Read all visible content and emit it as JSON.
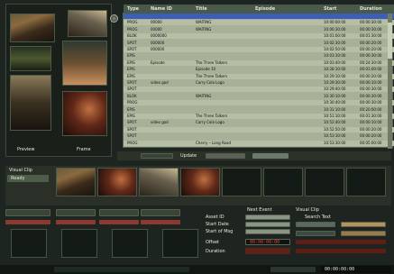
{
  "left_panel": {
    "preview_caption": "Preview",
    "frame_caption": "Frame"
  },
  "table": {
    "columns": [
      "Type",
      "Name ID",
      "Title",
      "Episode",
      "Start",
      "Duration"
    ],
    "rows": [
      {
        "type": "",
        "id": "",
        "title": "",
        "start": "",
        "duration": "",
        "selected": true
      },
      {
        "type": "PROG",
        "id": "00000",
        "title": "WAITING",
        "start": "10:00:00:00",
        "duration": "00:00:30:00"
      },
      {
        "type": "PROG",
        "id": "00000",
        "title": "WAITING",
        "start": "10:00:30:00",
        "duration": "00:00:30:00"
      },
      {
        "type": "BLOK",
        "id": "0000000",
        "title": "",
        "start": "10:01:00:00",
        "duration": "00:01:30:00"
      },
      {
        "type": "SPOT",
        "id": "000000",
        "title": "",
        "start": "10:02:30:00",
        "duration": "00:00:20:00"
      },
      {
        "type": "SPOT",
        "id": "000000",
        "title": "",
        "start": "10:02:50:00",
        "duration": "00:00:20:00"
      },
      {
        "type": "EPIS",
        "id": "",
        "title": "",
        "start": "10:03:10:00",
        "duration": "00:00:30:00"
      },
      {
        "type": "EPIS",
        "id": "Episode",
        "title": "The Three Talkers",
        "start": "10:03:40:00",
        "duration": "00:24:30:00"
      },
      {
        "type": "EPIS",
        "id": "",
        "title": "Episode 10",
        "start": "10:28:10:00",
        "duration": "00:01:00:00"
      },
      {
        "type": "EPIS",
        "id": "",
        "title": "The Three Talkers",
        "start": "10:29:10:00",
        "duration": "00:00:20:00"
      },
      {
        "type": "SPOT",
        "id": "video god",
        "title": "Carry Cola Logo",
        "start": "10:29:30:00",
        "duration": "00:00:10:00"
      },
      {
        "type": "SPOT",
        "id": "",
        "title": "",
        "start": "10:29:40:00",
        "duration": "00:00:30:00"
      },
      {
        "type": "BLOK",
        "id": "",
        "title": "WAITING",
        "start": "10:30:10:00",
        "duration": "00:00:30:00"
      },
      {
        "type": "PROG",
        "id": "",
        "title": "",
        "start": "10:30:40:00",
        "duration": "00:00:30:00"
      },
      {
        "type": "EPIS",
        "id": "",
        "title": "",
        "start": "10:31:10:00",
        "duration": "00:20:00:00"
      },
      {
        "type": "EPIS",
        "id": "",
        "title": "The Three Talkers",
        "start": "10:51:10:00",
        "duration": "00:01:30:00"
      },
      {
        "type": "SPOT",
        "id": "video god",
        "title": "Carry Cola Logo",
        "start": "10:52:40:00",
        "duration": "00:00:10:00"
      },
      {
        "type": "SPOT",
        "id": "",
        "title": "",
        "start": "10:52:50:00",
        "duration": "00:00:20:00"
      },
      {
        "type": "SPOT",
        "id": "",
        "title": "",
        "start": "10:53:10:00",
        "duration": "00:00:20:00"
      },
      {
        "type": "PROG",
        "id": "",
        "title": "Cherry – Lang Road",
        "start": "10:53:30:00",
        "duration": "00:05:00:00"
      }
    ]
  },
  "mid_bar": {
    "label_left": "",
    "label_mid": "Update",
    "label_right": ""
  },
  "clip_panel": {
    "caption_top": "Visual Clip",
    "caption_sub": "Ready"
  },
  "detail_panel": {
    "header_left": "Next Event",
    "header_right": "Visual Clip",
    "sub_right": "Search Text",
    "labels": [
      "Asset ID",
      "Start Date",
      "Start of Msg",
      "Offset",
      "Duration"
    ],
    "timecode": "00:00:00:00"
  },
  "status_bar": {
    "left": "",
    "right_counter": "00:00:00:00"
  },
  "colors": {
    "selected_row": "#3b5fb8",
    "row_bg": "#a8b098",
    "panel_bg": "#2a3a2e",
    "accent": "#c85a4a"
  }
}
